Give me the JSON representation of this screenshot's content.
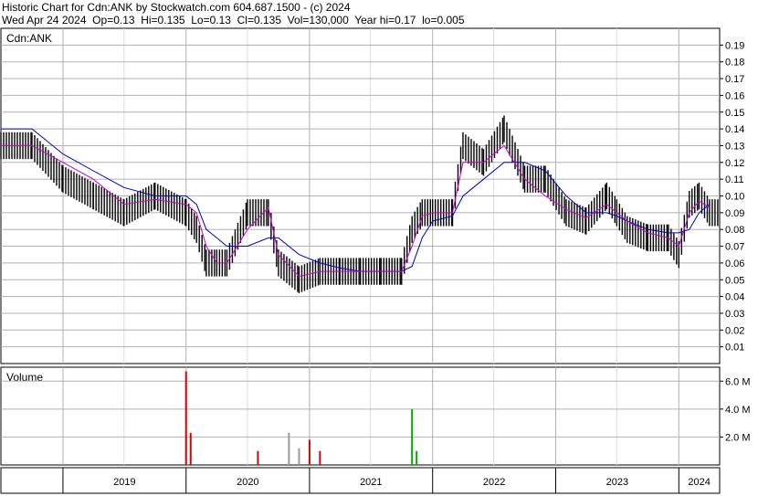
{
  "header": {
    "line1": "Historic Chart for Cdn:ANK by Stockwatch.com 604.687.1500 - (c) 2024",
    "line2": "Wed Apr 24 2024  Op=0.13  Hi=0.135  Lo=0.13  Cl=0.135  Vol=130,000  Year hi=0.17  lo=0.005"
  },
  "colors": {
    "price_bar": "#000000",
    "ma_short": "#cc00cc",
    "ma_long": "#0000cc",
    "vol_up": "#00aa00",
    "vol_down": "#dd0000",
    "vol_flat": "#999999",
    "grid": "#b0b0b0"
  },
  "chart_data": [
    {
      "type": "line",
      "title": "Cdn:ANK",
      "x_ticks": [
        "2019",
        "2020",
        "2021",
        "2022",
        "2023",
        "2024"
      ],
      "ylim": [
        0,
        0.2
      ],
      "y_ticks": [
        "0.01",
        "0.02",
        "0.03",
        "0.04",
        "0.05",
        "0.06",
        "0.07",
        "0.08",
        "0.09",
        "0.10",
        "0.11",
        "0.12",
        "0.13",
        "0.14",
        "0.15",
        "0.16",
        "0.17",
        "0.18",
        "0.19"
      ],
      "grid": true,
      "x_dates": [
        "2018-07",
        "2018-10",
        "2019-01",
        "2019-04",
        "2019-07",
        "2019-10",
        "2020-01",
        "2020-02",
        "2020-03",
        "2020-04",
        "2020-05",
        "2020-07",
        "2020-09",
        "2020-10",
        "2020-12",
        "2021-02",
        "2021-04",
        "2021-06",
        "2021-08",
        "2021-10",
        "2021-11",
        "2021-12",
        "2022-01",
        "2022-03",
        "2022-04",
        "2022-06",
        "2022-08",
        "2022-10",
        "2022-12",
        "2023-02",
        "2023-04",
        "2023-06",
        "2023-07",
        "2023-08",
        "2023-10",
        "2023-12",
        "2024-01",
        "2024-02",
        "2024-03",
        "2024-04"
      ],
      "series": [
        {
          "label": "price_close",
          "values": [
            0.13,
            0.13,
            0.11,
            0.1,
            0.09,
            0.1,
            0.09,
            0.08,
            0.06,
            0.06,
            0.06,
            0.09,
            0.09,
            0.06,
            0.05,
            0.055,
            0.055,
            0.055,
            0.055,
            0.055,
            0.08,
            0.09,
            0.09,
            0.09,
            0.13,
            0.12,
            0.14,
            0.11,
            0.11,
            0.09,
            0.085,
            0.1,
            0.09,
            0.08,
            0.075,
            0.075,
            0.065,
            0.095,
            0.1,
            0.09
          ]
        },
        {
          "label": "ma_short",
          "values": [
            0.13,
            0.13,
            0.12,
            0.11,
            0.095,
            0.098,
            0.095,
            0.09,
            0.07,
            0.06,
            0.06,
            0.08,
            0.093,
            0.065,
            0.052,
            0.055,
            0.055,
            0.055,
            0.055,
            0.055,
            0.07,
            0.088,
            0.09,
            0.09,
            0.12,
            0.12,
            0.13,
            0.11,
            0.1,
            0.092,
            0.087,
            0.095,
            0.09,
            0.085,
            0.078,
            0.075,
            0.07,
            0.09,
            0.097,
            0.093
          ]
        },
        {
          "label": "ma_long",
          "values": [
            0.14,
            0.14,
            0.125,
            0.115,
            0.105,
            0.1,
            0.1,
            0.095,
            0.08,
            0.075,
            0.07,
            0.07,
            0.075,
            0.075,
            0.065,
            0.06,
            0.057,
            0.055,
            0.055,
            0.055,
            0.058,
            0.075,
            0.085,
            0.088,
            0.1,
            0.11,
            0.12,
            0.12,
            0.115,
            0.1,
            0.09,
            0.09,
            0.088,
            0.085,
            0.08,
            0.078,
            0.078,
            0.08,
            0.09,
            0.095
          ]
        }
      ]
    },
    {
      "type": "bar",
      "title": "Volume",
      "y_ticks": [
        "2.0 M",
        "4.0 M",
        "6.0 M"
      ],
      "ylim": [
        0,
        7000000
      ],
      "bars": [
        {
          "x": "2020-01",
          "value": 6700000,
          "dir": "down"
        },
        {
          "x": "2020-01",
          "value": 2300000,
          "dir": "down"
        },
        {
          "x": "2020-08",
          "value": 1000000,
          "dir": "down"
        },
        {
          "x": "2020-11",
          "value": 2300000,
          "dir": "flat"
        },
        {
          "x": "2020-12",
          "value": 1200000,
          "dir": "flat"
        },
        {
          "x": "2021-01",
          "value": 1800000,
          "dir": "down"
        },
        {
          "x": "2021-02",
          "value": 1000000,
          "dir": "down"
        },
        {
          "x": "2021-11",
          "value": 4000000,
          "dir": "up"
        },
        {
          "x": "2021-11",
          "value": 1000000,
          "dir": "up"
        }
      ]
    }
  ]
}
